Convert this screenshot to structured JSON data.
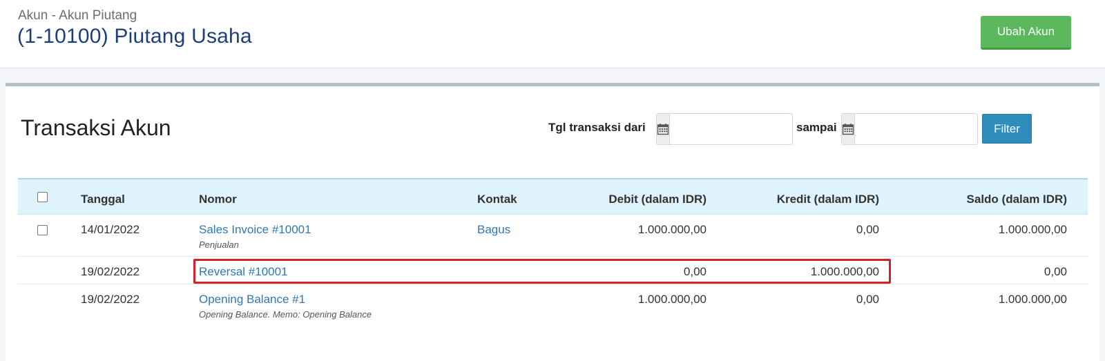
{
  "header": {
    "breadcrumb": "Akun - Akun Piutang",
    "title": "(1-10100) Piutang Usaha",
    "edit_button": "Ubah Akun"
  },
  "panel": {
    "title": "Transaksi Akun",
    "filter": {
      "from_label": "Tgl transaksi dari",
      "to_label": "sampai",
      "from_value": "",
      "to_value": "",
      "button": "Filter"
    }
  },
  "table": {
    "headers": {
      "tanggal": "Tanggal",
      "nomor": "Nomor",
      "kontak": "Kontak",
      "debit": "Debit (dalam IDR)",
      "kredit": "Kredit (dalam IDR)",
      "saldo": "Saldo (dalam IDR)"
    },
    "rows": [
      {
        "tanggal": "14/01/2022",
        "nomor": "Sales Invoice #10001",
        "memo": "Penjualan",
        "kontak": "Bagus",
        "debit": "1.000.000,00",
        "kredit": "0,00",
        "saldo": "1.000.000,00"
      },
      {
        "tanggal": "19/02/2022",
        "nomor": "Reversal #10001",
        "memo": "",
        "kontak": "",
        "debit": "0,00",
        "kredit": "1.000.000,00",
        "saldo": "0,00"
      },
      {
        "tanggal": "19/02/2022",
        "nomor": "Opening Balance #1",
        "memo": "Opening Balance. Memo: Opening Balance",
        "kontak": "",
        "debit": "1.000.000,00",
        "kredit": "0,00",
        "saldo": "1.000.000,00"
      }
    ]
  },
  "colors": {
    "title_blue": "#1c3f7c",
    "link_blue": "#2e77b8",
    "success_green": "#5cb85c",
    "filter_blue": "#2f8dbd",
    "highlight_red": "#d61f2c",
    "table_header_bg": "#dff3fc"
  },
  "icons": {
    "date_from": "calendar-icon",
    "date_to": "calendar-icon"
  }
}
